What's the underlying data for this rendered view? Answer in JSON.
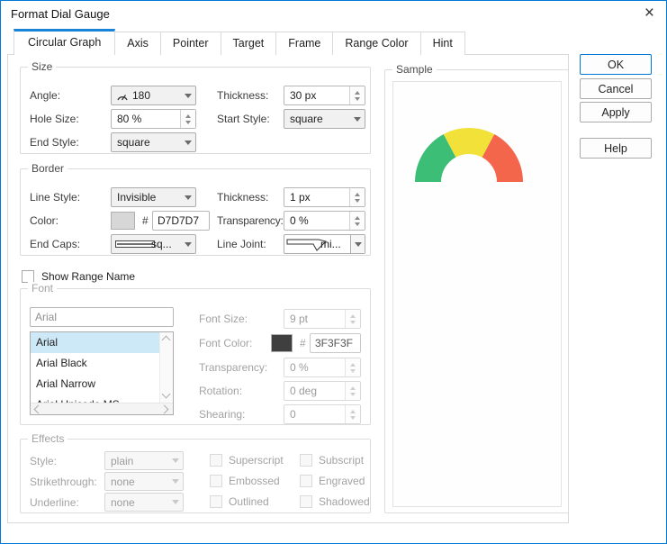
{
  "window": {
    "title": "Format Dial Gauge",
    "close_glyph": "×"
  },
  "tabs": [
    {
      "label": "Circular Graph",
      "active": true
    },
    {
      "label": "Axis",
      "active": false
    },
    {
      "label": "Pointer",
      "active": false
    },
    {
      "label": "Target",
      "active": false
    },
    {
      "label": "Frame",
      "active": false
    },
    {
      "label": "Range Color",
      "active": false
    },
    {
      "label": "Hint",
      "active": false
    }
  ],
  "size_group": {
    "title": "Size",
    "angle_label": "Angle:",
    "angle_value": "180",
    "thickness_label": "Thickness:",
    "thickness_value": "30 px",
    "hole_label": "Hole Size:",
    "hole_value": "80 %",
    "start_label": "Start Style:",
    "start_value": "square",
    "end_label": "End Style:",
    "end_value": "square"
  },
  "border_group": {
    "title": "Border",
    "line_style_label": "Line Style:",
    "line_style_value": "Invisible",
    "thickness_label": "Thickness:",
    "thickness_value": "1 px",
    "color_label": "Color:",
    "hash": "#",
    "color_value": "D7D7D7",
    "color_swatch": "#D7D7D7",
    "transparency_label": "Transparency:",
    "transparency_value": "0 %",
    "end_caps_label": "End Caps:",
    "end_caps_value": "sq...",
    "line_joint_label": "Line Joint:",
    "line_joint_value": "mi..."
  },
  "range_name": {
    "label": "Show Range Name",
    "checked": false
  },
  "font_group": {
    "title": "Font",
    "name_value": "Arial",
    "font_list": [
      "Arial",
      "Arial Black",
      "Arial Narrow",
      "Arial Unicode MS"
    ],
    "selected_font": "Arial",
    "size_label": "Font Size:",
    "size_value": "9 pt",
    "color_label": "Font Color:",
    "hash": "#",
    "color_value": "3F3F3F",
    "color_swatch": "#3F3F3F",
    "transparency_label": "Transparency:",
    "transparency_value": "0 %",
    "rotation_label": "Rotation:",
    "rotation_value": "0 deg",
    "shearing_label": "Shearing:",
    "shearing_value": "0"
  },
  "effects_group": {
    "title": "Effects",
    "style_label": "Style:",
    "style_value": "plain",
    "strike_label": "Strikethrough:",
    "strike_value": "none",
    "underline_label": "Underline:",
    "underline_value": "none",
    "checkboxes": [
      "Superscript",
      "Subscript",
      "Embossed",
      "Engraved",
      "Outlined",
      "Shadowed"
    ]
  },
  "sample": {
    "title": "Sample",
    "segment_colors": [
      "#3CBE76",
      "#F2E138",
      "#F3664C"
    ],
    "segments_deg": [
      [
        180,
        118
      ],
      [
        118,
        62
      ],
      [
        62,
        0
      ]
    ]
  },
  "buttons": {
    "ok": "OK",
    "cancel": "Cancel",
    "apply": "Apply",
    "help": "Help"
  }
}
